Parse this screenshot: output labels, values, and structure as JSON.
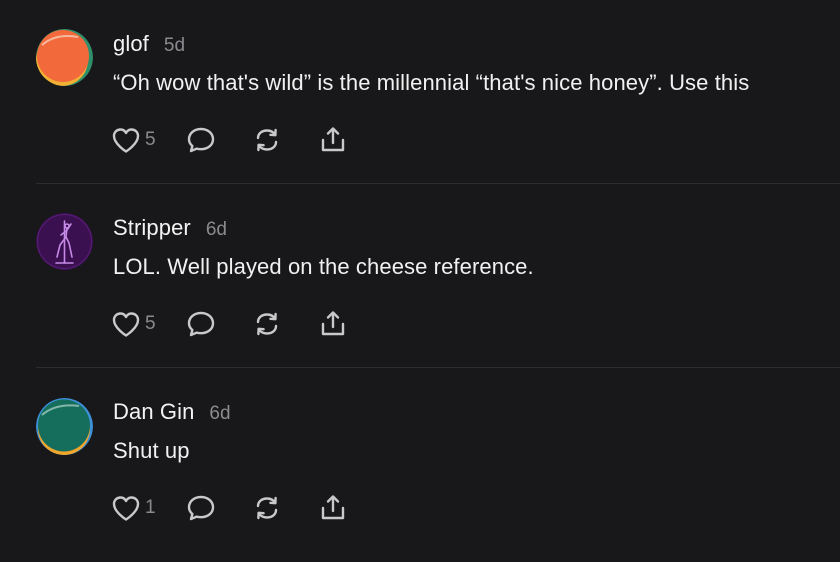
{
  "posts": [
    {
      "username": "glof",
      "age": "5d",
      "text": "“Oh wow that's wild” is the millennial “that's nice honey”. Use this",
      "like_count": "5",
      "avatar_colors": {
        "primary": "#f26a3b",
        "ring": "#2f8f6b",
        "accent": "#f2b134"
      }
    },
    {
      "username": "Stripper",
      "age": "6d",
      "text": "LOL. Well played on the cheese reference.",
      "like_count": "5",
      "avatar_colors": {
        "primary": "#3a1050",
        "figure": "#c58be6"
      }
    },
    {
      "username": "Dan Gin",
      "age": "6d",
      "text": "Shut up",
      "like_count": "1",
      "avatar_colors": {
        "primary": "#146e5b",
        "ring": "#3d8fd6",
        "accent": "#f2a62b"
      }
    }
  ],
  "icons": {
    "like": "heart-icon",
    "reply": "speech-bubble-icon",
    "repost": "repost-arrows-icon",
    "share": "share-upload-icon"
  },
  "colors": {
    "background": "#18181a",
    "text": "#f1f1f1",
    "muted": "#8b8b8f",
    "icon": "#c9c9cc",
    "divider": "#2c2c2f"
  }
}
